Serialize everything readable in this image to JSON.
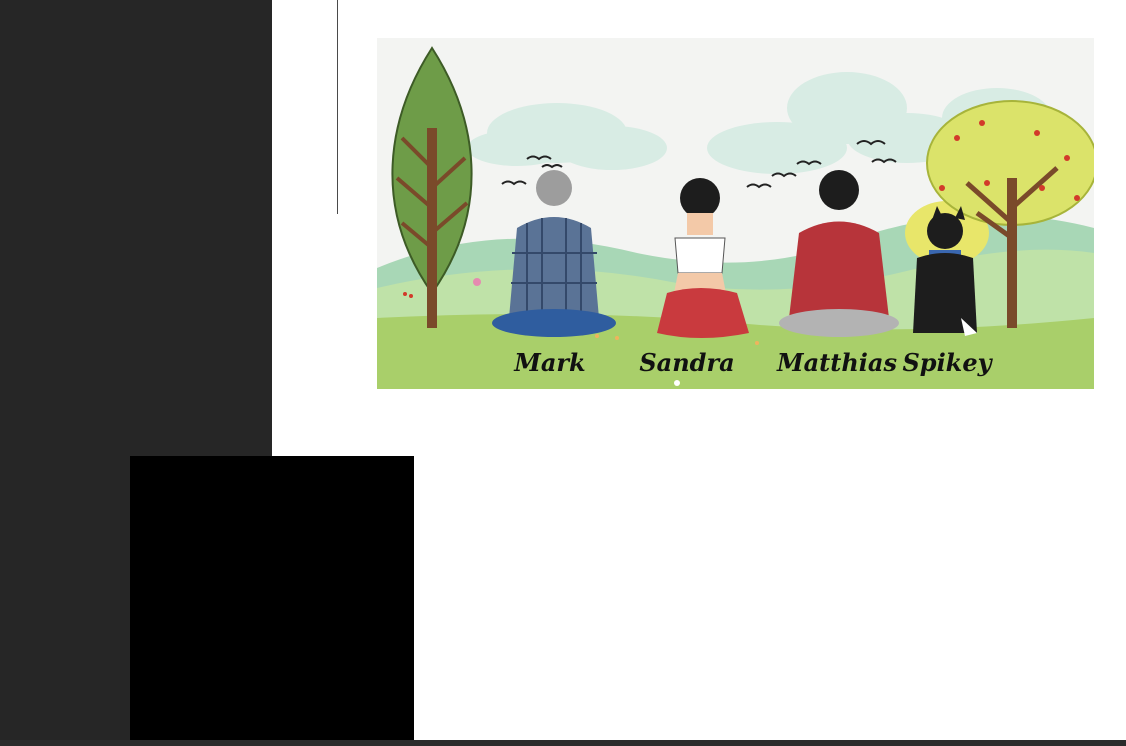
{
  "artwork": {
    "names": [
      "Mark",
      "Sandra",
      "Matthias",
      "Spikey"
    ],
    "colors": {
      "sky": "#f3f4f2",
      "cloud": "#d8ece4",
      "hill_back": "#a8d7b6",
      "hill_front": "#bfe2a8",
      "grass": "#a9cf6a",
      "shirt_plaid": "#5a7396",
      "skirt": "#c93a3e",
      "hoodie": "#b7343a",
      "dog": "#1d1d1d",
      "tree_green": "#6e9c48",
      "tree_yellow": "#dbe36a"
    }
  }
}
